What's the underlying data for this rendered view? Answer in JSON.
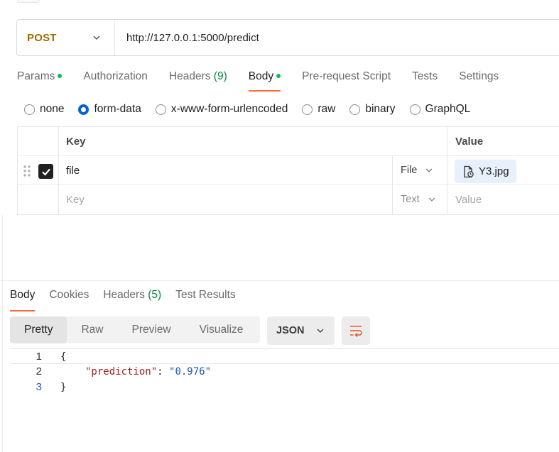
{
  "request": {
    "method": "POST",
    "url": "http://127.0.0.1:5000/predict"
  },
  "request_tabs": [
    {
      "label": "Params",
      "dot": true
    },
    {
      "label": "Authorization"
    },
    {
      "label": "Headers",
      "count": "(9)"
    },
    {
      "label": "Body",
      "dot": true,
      "active": true
    },
    {
      "label": "Pre-request Script"
    },
    {
      "label": "Tests"
    },
    {
      "label": "Settings"
    }
  ],
  "body_types": [
    {
      "label": "none",
      "checked": false
    },
    {
      "label": "form-data",
      "checked": true
    },
    {
      "label": "x-www-form-urlencoded",
      "checked": false
    },
    {
      "label": "raw",
      "checked": false
    },
    {
      "label": "binary",
      "checked": false
    },
    {
      "label": "GraphQL",
      "checked": false
    }
  ],
  "form_table": {
    "header_key": "Key",
    "header_value": "Value",
    "rows": [
      {
        "key": "file",
        "type": "File",
        "value": "Y3.jpg",
        "checked": true
      },
      {
        "key_placeholder": "Key",
        "type": "Text",
        "value_placeholder": "Value"
      }
    ]
  },
  "response_tabs": [
    {
      "label": "Body",
      "active": true
    },
    {
      "label": "Cookies"
    },
    {
      "label": "Headers",
      "count": "(5)"
    },
    {
      "label": "Test Results"
    }
  ],
  "view_modes": [
    {
      "label": "Pretty",
      "active": true
    },
    {
      "label": "Raw"
    },
    {
      "label": "Preview"
    },
    {
      "label": "Visualize"
    }
  ],
  "format": "JSON",
  "response_code": {
    "line_numbers": [
      "1",
      "2",
      "3"
    ],
    "open_brace": "{",
    "key": "\"prediction\"",
    "colon": ": ",
    "value": "\"0.976\"",
    "close_brace": "}"
  },
  "colors": {
    "method": "#a06a00",
    "active_tab_underline": "#ff6c37",
    "status_dot": "#0cbb52",
    "radio_checked": "#0265d2",
    "json_key": "#a11f1f",
    "json_string": "#1f55a8"
  },
  "icons": [
    "chevron-down-icon",
    "drag-handle-icon",
    "checkbox-checked-icon",
    "file-icon",
    "wrap-lines-icon"
  ]
}
